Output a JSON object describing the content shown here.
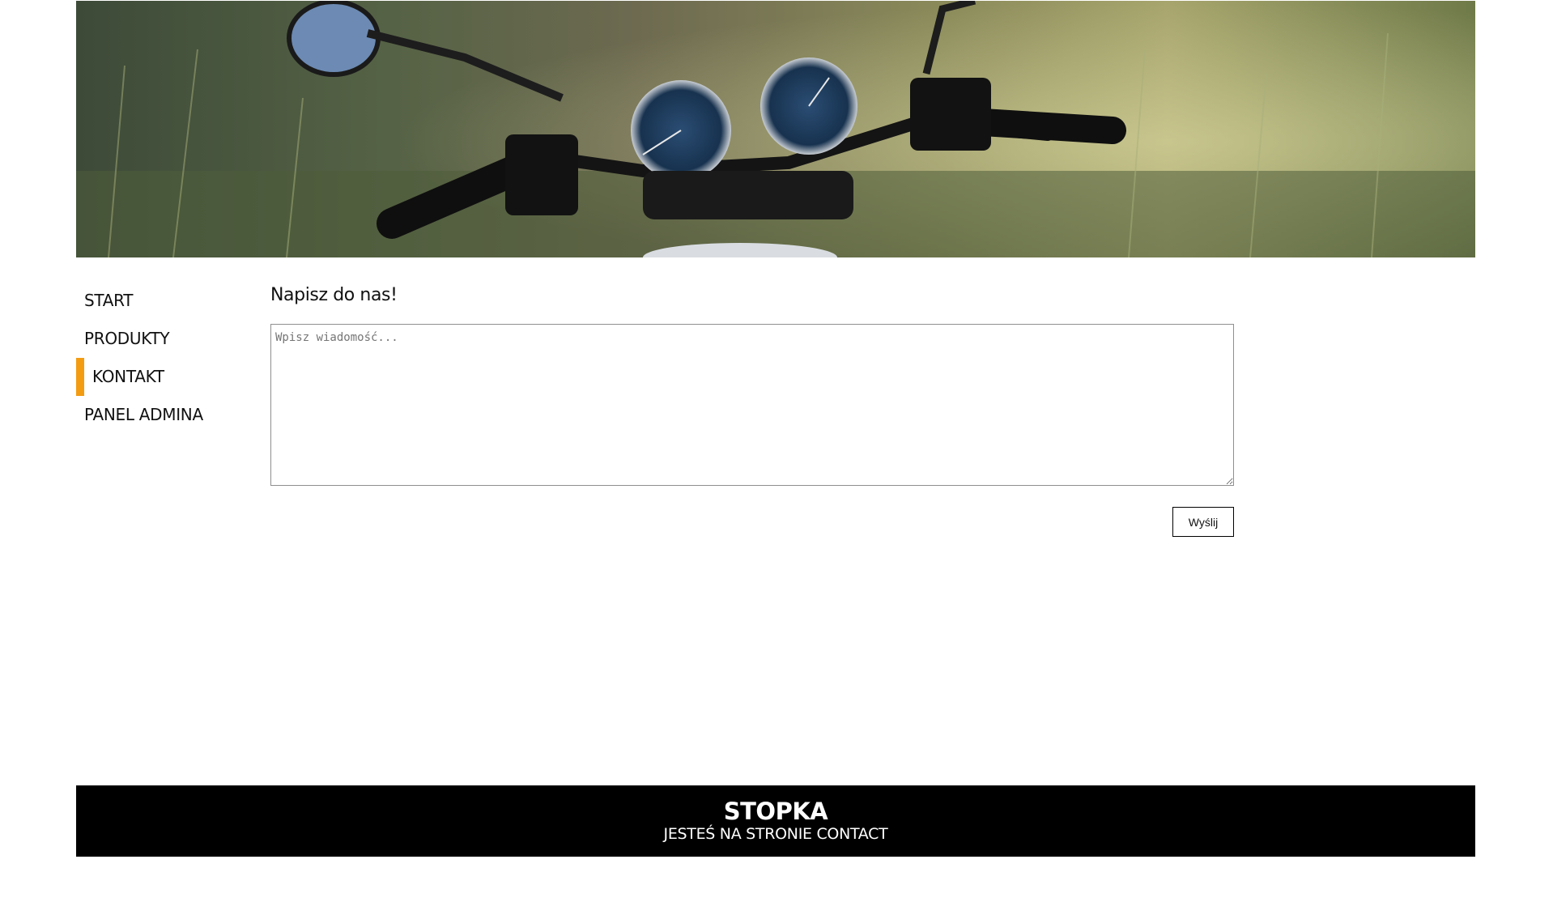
{
  "banner": {
    "alt": "motorcycle-handlebars-photo"
  },
  "nav": {
    "items": [
      {
        "label": "START"
      },
      {
        "label": "PRODUKTY"
      },
      {
        "label": "KONTAKT",
        "active": true
      },
      {
        "label": "PANEL ADMINA"
      }
    ],
    "active_color": "#f39c12"
  },
  "main": {
    "title": "Napisz do nas!",
    "textarea": {
      "placeholder": "Wpisz wiadomość...",
      "value": ""
    },
    "send_label": "Wyślij"
  },
  "footer": {
    "title": "STOPKA",
    "subtitle": "JESTEŚ NA STRONIE CONTACT"
  }
}
